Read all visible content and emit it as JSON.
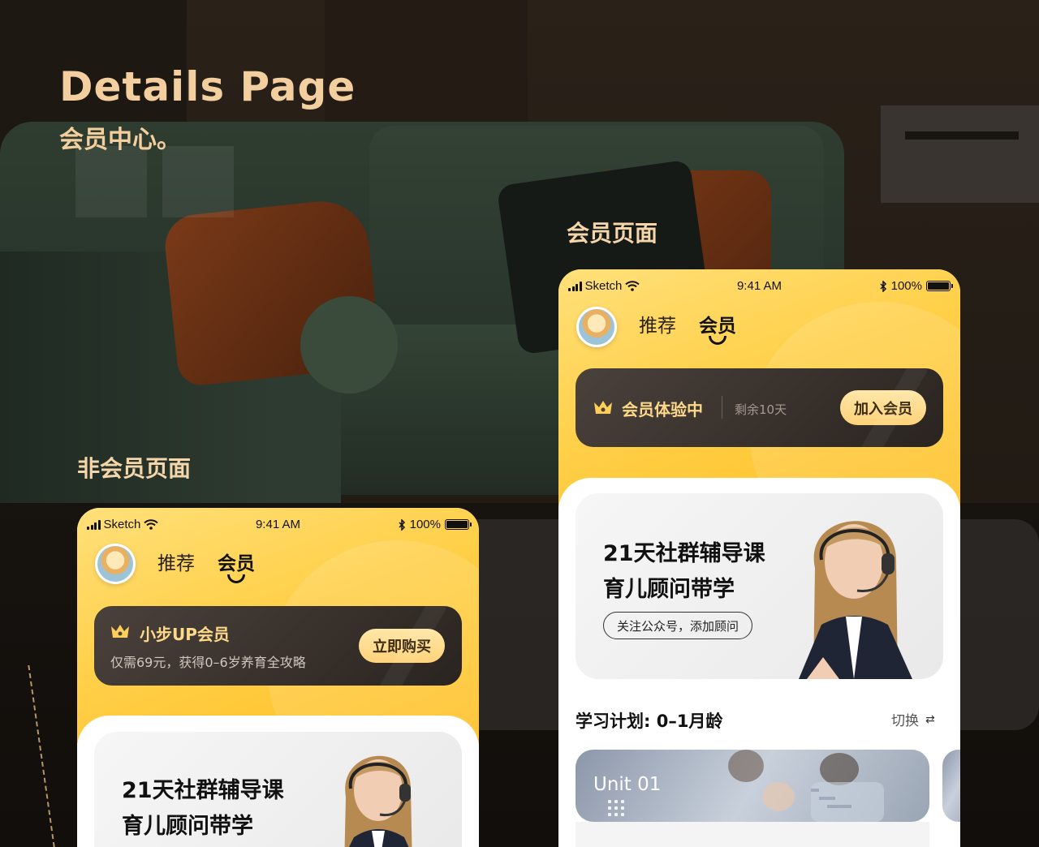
{
  "page": {
    "title": "Details Page",
    "subtitle": "会员中心。"
  },
  "labels": {
    "non_member": "非会员页面",
    "member": "会员页面"
  },
  "status_bar": {
    "carrier": "Sketch",
    "time": "9:41 AM",
    "battery": "100%"
  },
  "tabs": {
    "recommend": "推荐",
    "member": "会员"
  },
  "non_member_phone": {
    "card_title": "小步UP会员",
    "card_desc": "仅需69元，获得0–6岁养育全攻略",
    "buy_button": "立即购买",
    "course_line1": "21天社群辅导课",
    "course_line2": "育儿顾问带学"
  },
  "member_phone": {
    "card_title": "会员体验中",
    "card_remaining": "剩余10天",
    "join_button": "加入会员",
    "course_line1": "21天社群辅导课",
    "course_line2": "育儿顾问带学",
    "follow_button": "关注公众号，添加顾问",
    "plan_title": "学习计划: 0–1月龄",
    "switch_label": "切换",
    "unit_label": "Unit 01"
  },
  "colors": {
    "brand_yellow": "#FFD04A",
    "title_gold": "#F3CFA0",
    "card_dark": "#2A2420"
  },
  "icons": [
    "wifi-icon",
    "bluetooth-icon",
    "battery-icon",
    "crown-icon",
    "swap-icon",
    "signal-icon"
  ]
}
